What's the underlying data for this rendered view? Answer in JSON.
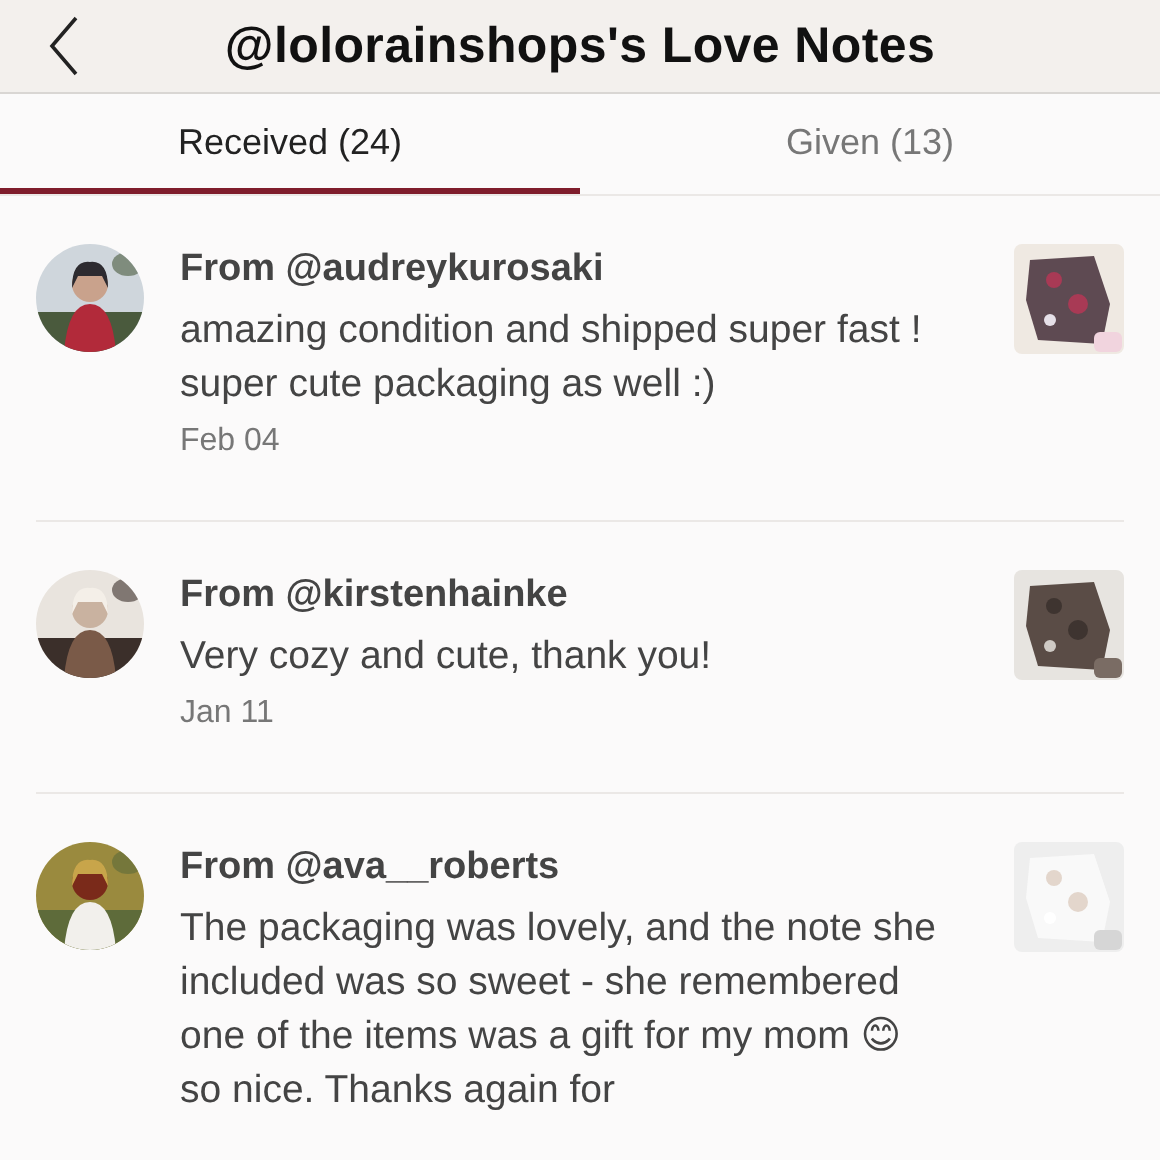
{
  "header": {
    "title": "@lolorainshops's Love Notes"
  },
  "tabs": [
    {
      "label": "Received (24)",
      "selected": true
    },
    {
      "label": "Given (13)",
      "selected": false
    }
  ],
  "notes": [
    {
      "from": "From @audreykurosaki",
      "message": "amazing condition and shipped super fast ! super cute packaging as well :)",
      "date": "Feb 04"
    },
    {
      "from": "From @kirstenhainke",
      "message": "Very cozy and cute, thank you!",
      "date": "Jan 11"
    },
    {
      "from": "From @ava__roberts",
      "message": "The packaging was lovely, and the note she included was so sweet - she remembered one of the items was a gift for my mom 😊 so nice. Thanks again for"
    }
  ]
}
